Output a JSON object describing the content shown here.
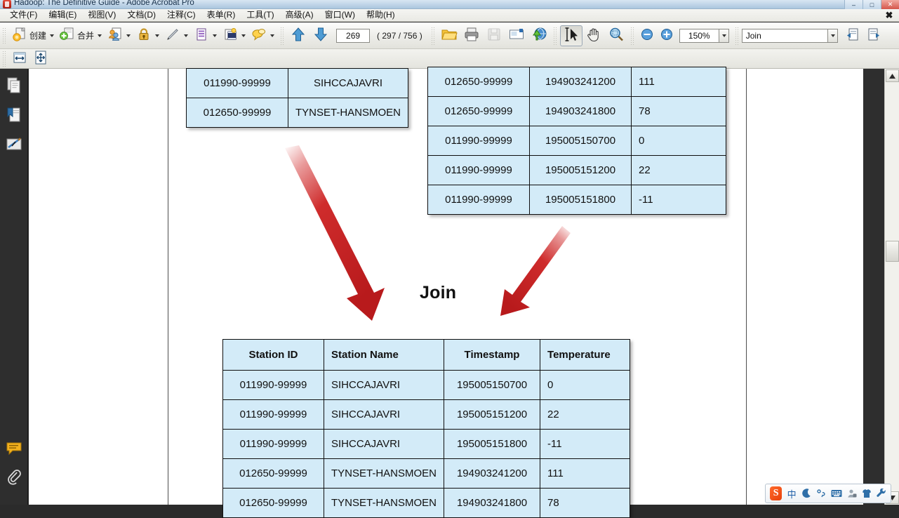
{
  "window": {
    "title": "Hadoop: The Definitive Guide - Adobe Acrobat Pro",
    "minimize_label": "–",
    "maximize_label": "□",
    "close_label": "✕",
    "menu_close_label": "✖"
  },
  "menu": {
    "items": [
      {
        "label": "文件(F)",
        "name": "menu-file"
      },
      {
        "label": "编辑(E)",
        "name": "menu-edit"
      },
      {
        "label": "视图(V)",
        "name": "menu-view"
      },
      {
        "label": "文档(D)",
        "name": "menu-document"
      },
      {
        "label": "注释(C)",
        "name": "menu-comments"
      },
      {
        "label": "表单(R)",
        "name": "menu-forms"
      },
      {
        "label": "工具(T)",
        "name": "menu-tools"
      },
      {
        "label": "高级(A)",
        "name": "menu-advanced"
      },
      {
        "label": "窗口(W)",
        "name": "menu-window"
      },
      {
        "label": "帮助(H)",
        "name": "menu-help"
      }
    ]
  },
  "toolbar": {
    "create_label": "创建",
    "combine_label": "合并",
    "page_number": "269",
    "page_total": "( 297 / 756 )",
    "zoom_value": "150%",
    "find_value": "Join",
    "icons": {
      "create": "create-pdf-icon",
      "combine": "combine-files-icon",
      "collaborate": "collaborate-icon",
      "secure": "secure-lock-icon",
      "sign": "sign-pen-icon",
      "forms": "forms-icon",
      "multimedia": "multimedia-icon",
      "comment": "comment-icon",
      "prev_page": "arrow-up-icon",
      "next_page": "arrow-down-icon",
      "open": "open-folder-icon",
      "print": "printer-icon",
      "save": "save-disk-icon",
      "email": "email-icon",
      "upload": "upload-globe-icon",
      "select": "text-select-icon",
      "hand": "hand-tool-icon",
      "marquee_zoom": "marquee-zoom-icon",
      "zoom_out": "zoom-out-icon",
      "zoom_in": "zoom-in-icon",
      "find_prev": "find-previous-icon",
      "find_next": "find-next-icon",
      "fit_width": "fit-width-icon",
      "fit_page": "fit-page-icon"
    }
  },
  "sidebar": {
    "items": [
      {
        "label": "页面缩略图",
        "name": "sidebar-page-thumbnails",
        "icon": "pages-icon"
      },
      {
        "label": "书签",
        "name": "sidebar-bookmarks",
        "icon": "bookmark-icon"
      },
      {
        "label": "签名",
        "name": "sidebar-signatures",
        "icon": "signature-icon"
      },
      {
        "label": "注释",
        "name": "sidebar-comments",
        "icon": "comment-bubble-icon"
      },
      {
        "label": "附件",
        "name": "sidebar-attachments",
        "icon": "paperclip-icon"
      }
    ]
  },
  "document": {
    "join_label": "Join",
    "table_stations": {
      "name": "station-table",
      "rows": [
        [
          "011990-99999",
          "SIHCCAJAVRI"
        ],
        [
          "012650-99999",
          "TYNSET-HANSMOEN"
        ]
      ]
    },
    "table_records": {
      "name": "records-table",
      "rows": [
        [
          "012650-99999",
          "194903241200",
          "111"
        ],
        [
          "012650-99999",
          "194903241800",
          "78"
        ],
        [
          "011990-99999",
          "195005150700",
          "0"
        ],
        [
          "011990-99999",
          "195005151200",
          "22"
        ],
        [
          "011990-99999",
          "195005151800",
          "-11"
        ]
      ]
    },
    "table_joined": {
      "name": "joined-table",
      "headers": [
        "Station ID",
        "Station Name",
        "Timestamp",
        "Temperature"
      ],
      "rows": [
        [
          "011990-99999",
          "SIHCCAJAVRI",
          "195005150700",
          "0"
        ],
        [
          "011990-99999",
          "SIHCCAJAVRI",
          "195005151200",
          "22"
        ],
        [
          "011990-99999",
          "SIHCCAJAVRI",
          "195005151800",
          "-11"
        ],
        [
          "012650-99999",
          "TYNSET-HANSMOEN",
          "194903241200",
          "111"
        ],
        [
          "012650-99999",
          "TYNSET-HANSMOEN",
          "194903241800",
          "78"
        ]
      ]
    },
    "arrow_color": "#cc2026"
  },
  "ime": {
    "logo": "S",
    "mode": "中",
    "items": [
      "moon-icon",
      "degree-comma-icon",
      "keyboard-icon",
      "user-icon",
      "skin-shirt-icon",
      "wrench-icon"
    ]
  }
}
